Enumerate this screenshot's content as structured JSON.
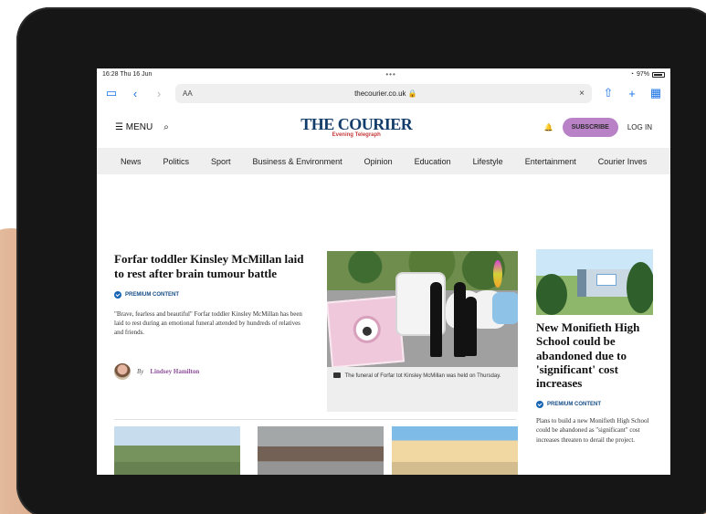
{
  "device_status": {
    "time": "16:28",
    "date": "Thu 16 Jun",
    "menu_dots": "•••",
    "battery": "97%"
  },
  "browser": {
    "text_size_label": "AA",
    "url": "thecourier.co.uk",
    "lock_symbol": "🔒"
  },
  "site": {
    "menu_label": "MENU",
    "logo_title": "THE COURIER",
    "logo_subtitle": "Evening Telegraph",
    "subscribe_label": "SUBSCRIBE",
    "login_label": "LOG IN"
  },
  "navigation": {
    "items": [
      "News",
      "Politics",
      "Sport",
      "Business & Environment",
      "Opinion",
      "Education",
      "Lifestyle",
      "Entertainment",
      "Courier Inves"
    ]
  },
  "lead_story": {
    "title": "Forfar toddler Kinsley McMillan laid to rest after brain tumour battle",
    "premium_label": "PREMIUM CONTENT",
    "summary": "\"Brave, fearless and beautiful\" Forfar toddler Kinsley McMillan has been laid to rest during an emotional funeral attended by hundreds of relatives and friends.",
    "byline_prefix": "By",
    "author": "Lindsey Hamilton",
    "photo_caption": "The funeral of Forfar tot Kinsley McMillan was held on Thursday."
  },
  "side_story": {
    "title": "New Monifieth High School could be abandoned due to 'significant' cost increases",
    "premium_label": "PREMIUM CONTENT",
    "summary": "Plans to build a new Monifieth High School could be abandoned as \"significant\" cost increases threaten to derail the project."
  },
  "icons": {
    "sidebar": "sidebar-icon",
    "back": "back-chevron-icon",
    "forward": "forward-chevron-icon",
    "close": "close-icon",
    "share": "share-icon",
    "new_tab": "plus-icon",
    "tabs": "tabs-grid-icon",
    "menu": "hamburger-menu-icon",
    "search": "search-icon",
    "notification": "bell-icon",
    "premium": "premium-check-icon",
    "camera": "camera-icon"
  },
  "colors": {
    "brand_blue": "#123d6b",
    "subscribe_purple": "#b982c7",
    "premium_blue": "#1664b4",
    "author_purple": "#8e4d9a"
  }
}
